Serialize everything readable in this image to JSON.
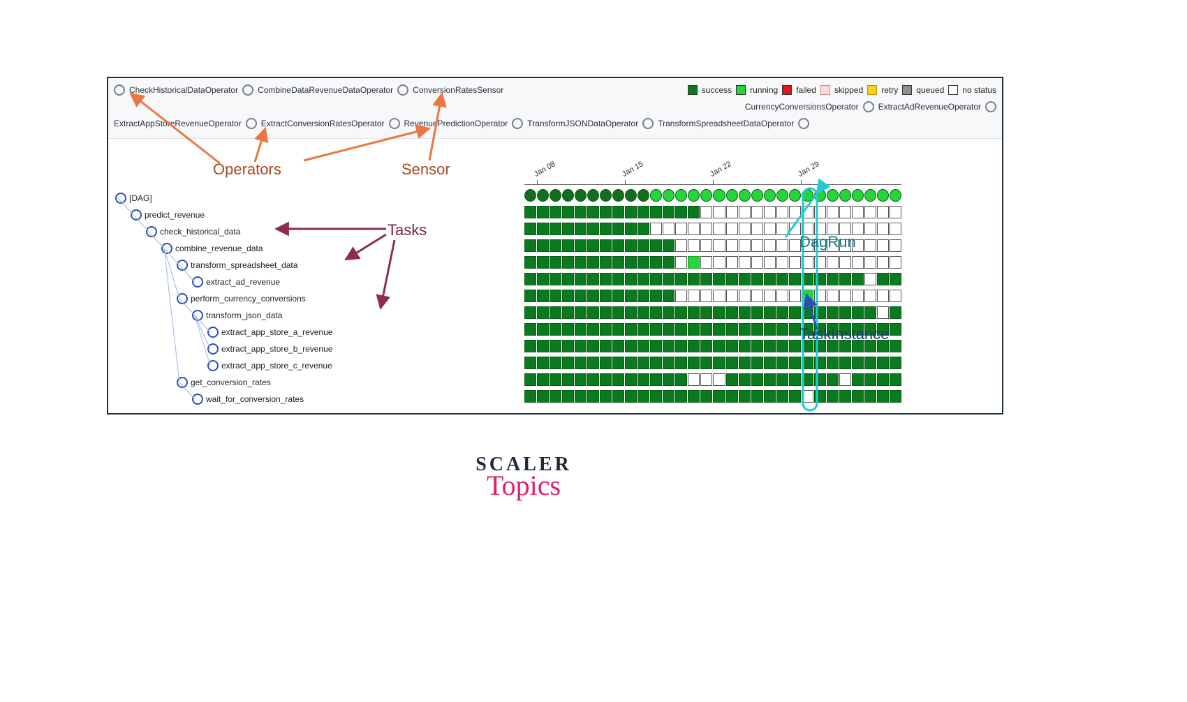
{
  "operators_row1": [
    "CheckHistoricalDataOperator",
    "CombineDataRevenueDataOperator",
    "ConversionRatesSensor"
  ],
  "status_legend": [
    {
      "key": "success",
      "label": "success"
    },
    {
      "key": "running",
      "label": "running"
    },
    {
      "key": "failed",
      "label": "failed"
    },
    {
      "key": "skipped",
      "label": "skipped"
    },
    {
      "key": "retry",
      "label": "retry"
    },
    {
      "key": "queued",
      "label": "queued"
    },
    {
      "key": "nostatus",
      "label": "no status"
    }
  ],
  "operators_row2_right": [
    "CurrencyConversionsOperator",
    "ExtractAdRevenueOperator"
  ],
  "operators_row3": [
    "ExtractAppStoreRevenueOperator",
    "ExtractConversionRatesOperator",
    "RevenuePredictionOperator",
    "TransformJSONDataOperator",
    "TransformSpreadsheetDataOperator"
  ],
  "annotations": {
    "operators": "Operators",
    "sensor": "Sensor",
    "tasks": "Tasks",
    "dagrun": "DagRun",
    "taskinstance": "TaskInstance"
  },
  "tree_root": "[DAG]",
  "tree_nodes": [
    {
      "indent": 0,
      "label": "[DAG]"
    },
    {
      "indent": 1,
      "label": "predict_revenue"
    },
    {
      "indent": 2,
      "label": "check_historical_data"
    },
    {
      "indent": 3,
      "label": "combine_revenue_data"
    },
    {
      "indent": 4,
      "label": "transform_spreadsheet_data"
    },
    {
      "indent": 5,
      "label": "extract_ad_revenue"
    },
    {
      "indent": 4,
      "label": "perform_currency_conversions"
    },
    {
      "indent": 5,
      "label": "transform_json_data"
    },
    {
      "indent": 6,
      "label": "extract_app_store_a_revenue"
    },
    {
      "indent": 6,
      "label": "extract_app_store_b_revenue"
    },
    {
      "indent": 6,
      "label": "extract_app_store_c_revenue"
    },
    {
      "indent": 4,
      "label": "get_conversion_rates"
    },
    {
      "indent": 5,
      "label": "wait_for_conversion_rates"
    }
  ],
  "timeline_ticks": [
    "Jan 08",
    "Jan 15",
    "Jan 22",
    "Jan 29"
  ],
  "run_row": "ddddddddddbbbbbbbbbbbbbbbbbbbb",
  "grid_rows": [
    "ssssssssssssssnnnnnnnnnnnnnnnn",
    "ssssssssssnnnnnnnnnnnnnnnnnnnn",
    "ssssssssssssnnnnnnnnnnnnnnnnnn",
    "ssssssssssssnrnnnnnnnnnnnnnnnn",
    "sssssssssssssssssssssssssssnss",
    "ssssssssssssnnnnnnnnnnrnnnnnnn",
    "ssssssssssssssssssssssssssssns",
    "ssssssssssssssssssssssssssssss",
    "ssssssssssssssssssssssssssssss",
    "ssssssssssssssssssssssssssssss",
    "sssssssssssssnnnsssssssssnssss",
    "ssssssssssssssssssssssnsssssss"
  ],
  "brand": {
    "line1": "SCALER",
    "line2": "Topics"
  }
}
